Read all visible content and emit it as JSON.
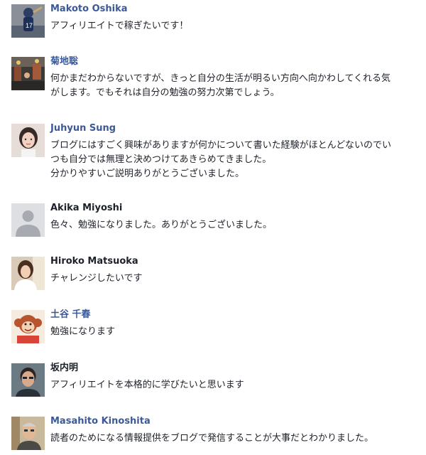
{
  "comments": [
    {
      "author": "Makoto Oshika",
      "author_linked": true,
      "avatar_icon": "baseball-player-photo",
      "lines": [
        "アフィリエイトで稼ぎたいです！"
      ]
    },
    {
      "author": "菊地聡",
      "author_linked": true,
      "avatar_icon": "street-scene-photo",
      "lines": [
        "何かまだわからないですが、きっと自分の生活が明るい方向へ向かわしてくれる気",
        "がします。でもそれは自分の勉強の努力次第でしょう。"
      ]
    },
    {
      "author": "Juhyun Sung",
      "author_linked": true,
      "avatar_icon": "woman-portrait-photo",
      "lines": [
        "ブログにはすごく興味がありますが何かについて書いた経験がほとんどないのでい",
        "つも自分では無理と決めつけてあきらめてきました。",
        "分かりやすいご説明ありがとうございました。"
      ]
    },
    {
      "author": "Akika Miyoshi",
      "author_linked": false,
      "avatar_icon": "default-user-silhouette",
      "lines": [
        "色々、勉強になりました。ありがとうございました。"
      ]
    },
    {
      "author": "Hiroko Matsuoka",
      "author_linked": false,
      "avatar_icon": "woman-photo",
      "lines": [
        "チャレンジしたいです"
      ]
    },
    {
      "author": "土谷 千春",
      "author_linked": true,
      "avatar_icon": "monkey-illustration",
      "lines": [
        "勉強になります"
      ]
    },
    {
      "author": "坂内明",
      "author_linked": false,
      "avatar_icon": "man-portrait-photo",
      "lines": [
        "アフィリエイトを本格的に学びたいと思います"
      ]
    },
    {
      "author": "Masahito Kinoshita",
      "author_linked": true,
      "avatar_icon": "elderly-man-photo",
      "lines": [
        "読者のためになる情報提供をブログで発信することが大事だとわかりました。"
      ]
    }
  ],
  "colors": {
    "link": "#3b5998",
    "text": "#1d2129"
  }
}
